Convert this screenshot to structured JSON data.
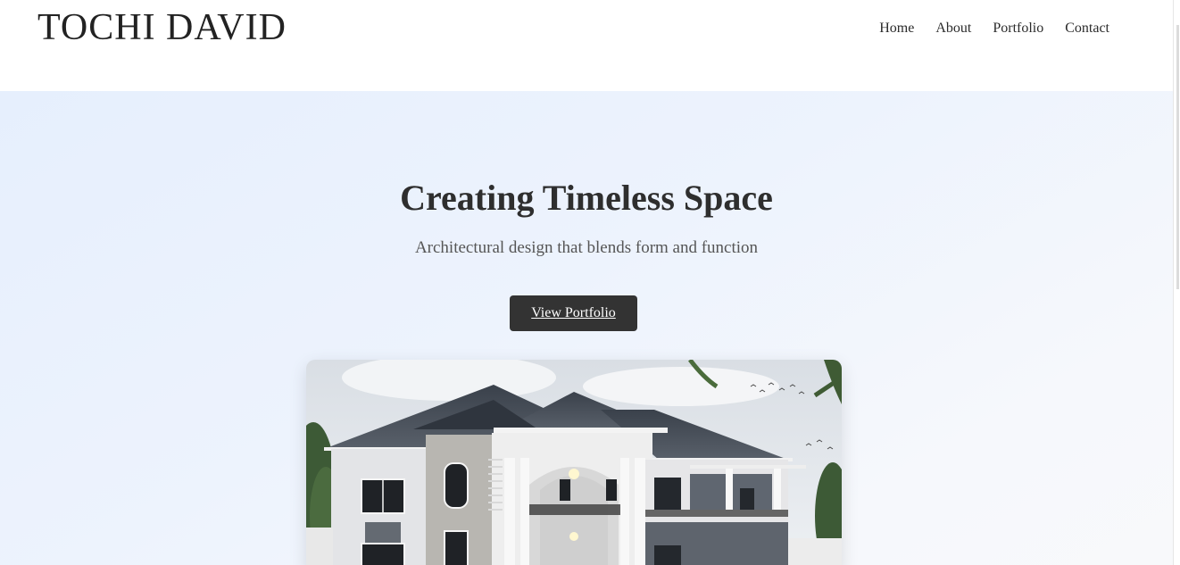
{
  "header": {
    "logo": "TOCHI DAVID",
    "nav": [
      "Home",
      "About",
      "Portfolio",
      "Contact"
    ]
  },
  "hero": {
    "title": "Creating Timeless Space",
    "subtitle": "Architectural design that blends form and function",
    "cta_label": "View Portfolio",
    "image_subject": "house-rendering"
  },
  "colors": {
    "text": "#2e2e2e",
    "button": "#333333",
    "hero_bg": "#eaf1fd"
  }
}
